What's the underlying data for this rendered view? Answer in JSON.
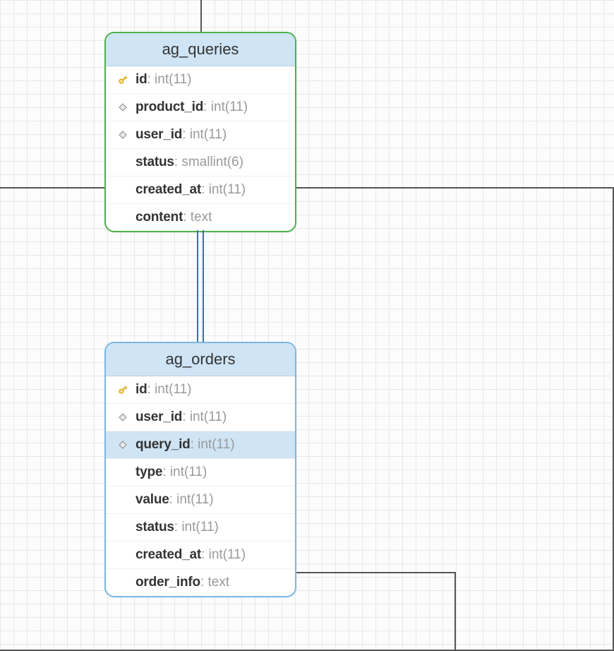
{
  "tables": {
    "queries": {
      "title": "ag_queries",
      "fields": [
        {
          "name": "id",
          "type": ": int(11)",
          "icon": "key",
          "selected": false
        },
        {
          "name": "product_id",
          "type": ": int(11)",
          "icon": "diamond",
          "selected": false
        },
        {
          "name": "user_id",
          "type": ": int(11)",
          "icon": "diamond",
          "selected": false
        },
        {
          "name": "status",
          "type": ": smallint(6)",
          "icon": "none",
          "selected": false
        },
        {
          "name": "created_at",
          "type": ": int(11)",
          "icon": "none",
          "selected": false
        },
        {
          "name": "content",
          "type": ": text",
          "icon": "none",
          "selected": false
        }
      ]
    },
    "orders": {
      "title": "ag_orders",
      "fields": [
        {
          "name": "id",
          "type": ": int(11)",
          "icon": "key",
          "selected": false
        },
        {
          "name": "user_id",
          "type": ": int(11)",
          "icon": "diamond",
          "selected": false
        },
        {
          "name": "query_id",
          "type": ": int(11)",
          "icon": "diamond",
          "selected": true
        },
        {
          "name": "type",
          "type": ": int(11)",
          "icon": "none",
          "selected": false
        },
        {
          "name": "value",
          "type": ": int(11)",
          "icon": "none",
          "selected": false
        },
        {
          "name": "status",
          "type": ": int(11)",
          "icon": "none",
          "selected": false
        },
        {
          "name": "created_at",
          "type": ": int(11)",
          "icon": "none",
          "selected": false
        },
        {
          "name": "order_info",
          "type": ": text",
          "icon": "none",
          "selected": false
        }
      ]
    }
  }
}
